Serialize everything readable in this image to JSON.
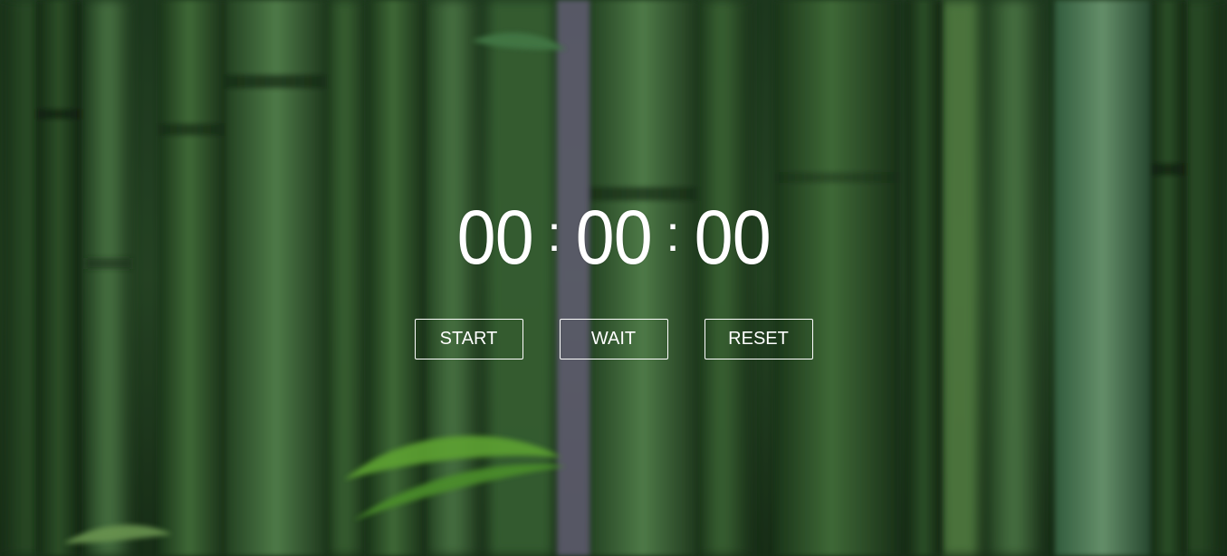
{
  "stopwatch": {
    "hours": "00",
    "minutes": "00",
    "seconds": "00",
    "separator": ":"
  },
  "controls": {
    "start_label": "START",
    "wait_label": "WAIT",
    "reset_label": "RESET"
  },
  "colors": {
    "text": "#ffffff",
    "button_border": "#ffffff",
    "background_dark": "#1c3a1e",
    "background_mid": "#3f6b37",
    "leaf_green": "#6fbf3a"
  }
}
